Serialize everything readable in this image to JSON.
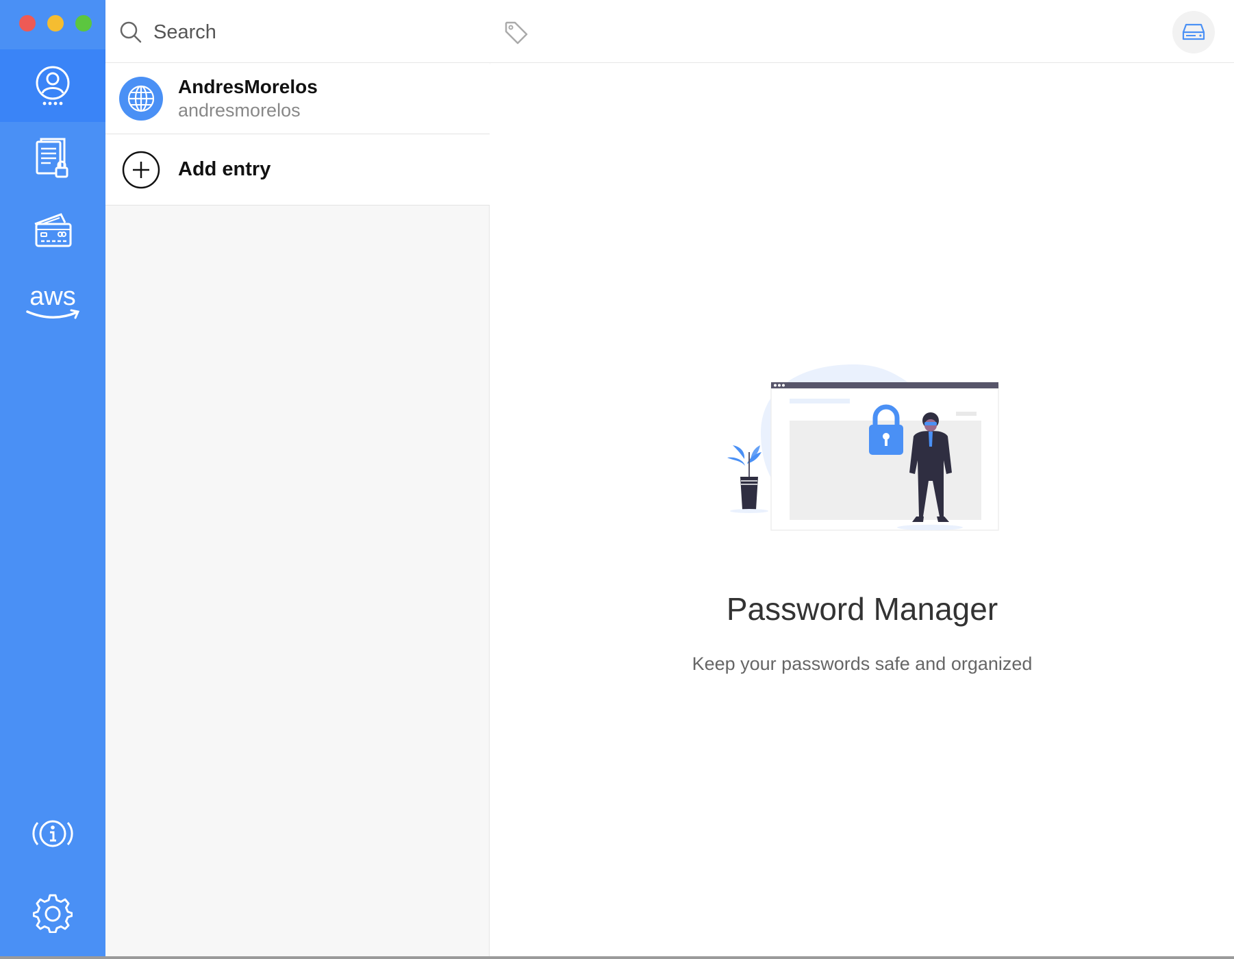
{
  "window": {
    "controls": [
      "close",
      "minimize",
      "maximize"
    ],
    "colors": {
      "close": "#ee5a55",
      "minimize": "#f5bd31",
      "maximize": "#5cc63f"
    }
  },
  "sidebar": {
    "accent": "#4a90f5",
    "items": [
      {
        "icon": "user-password-icon",
        "active": true
      },
      {
        "icon": "secure-notes-icon",
        "active": false
      },
      {
        "icon": "credit-cards-icon",
        "active": false
      },
      {
        "icon": "aws-icon",
        "label": "aws",
        "active": false
      }
    ],
    "bottom_items": [
      {
        "icon": "info-icon"
      },
      {
        "icon": "gear-icon"
      }
    ]
  },
  "topbar": {
    "search": {
      "placeholder": "Search",
      "value": ""
    },
    "tag_icon": "tag-icon",
    "drive_icon": "drive-icon"
  },
  "entries": [
    {
      "icon": "globe-icon",
      "title": "AndresMorelos",
      "subtitle": "andresmorelos"
    }
  ],
  "add_entry": {
    "label": "Add entry",
    "icon": "plus-circle-icon"
  },
  "main": {
    "title": "Password Manager",
    "subtitle": "Keep your passwords safe and organized"
  }
}
